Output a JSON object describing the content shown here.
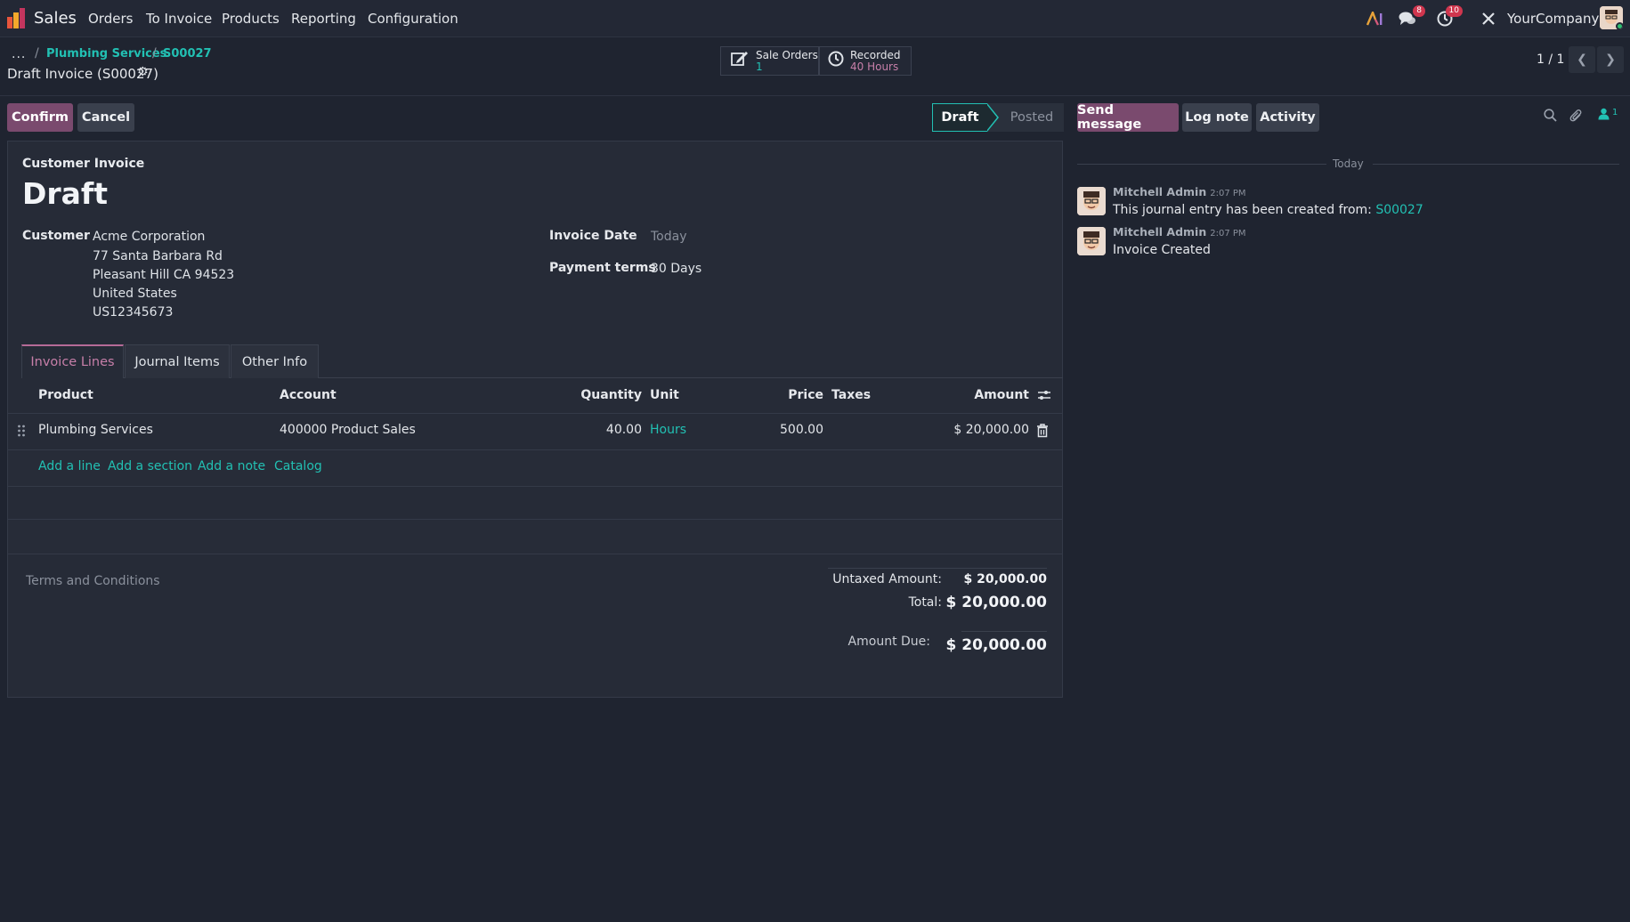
{
  "nav": {
    "app_name": "Sales",
    "menu": [
      "Orders",
      "To Invoice",
      "Products",
      "Reporting",
      "Configuration"
    ],
    "messages_badge": "8",
    "activities_badge": "10",
    "company": "YourCompany"
  },
  "breadcrumb": {
    "dots": "...",
    "items": [
      "Plumbing Services",
      "S00027"
    ],
    "record_title": "Draft Invoice (S00027)"
  },
  "smart_buttons": {
    "sale_orders_label": "Sale Orders",
    "sale_orders_count": "1",
    "recorded_label": "Recorded",
    "recorded_value": "40 Hours"
  },
  "pager": {
    "text": "1 / 1"
  },
  "actions": {
    "confirm": "Confirm",
    "cancel": "Cancel"
  },
  "status": {
    "current": "Draft",
    "next": "Posted"
  },
  "form": {
    "doc_type": "Customer Invoice",
    "name": "Draft",
    "customer_label": "Customer",
    "customer_lines": [
      "Acme Corporation",
      "77 Santa Barbara Rd",
      "Pleasant Hill CA 94523",
      "United States",
      "US12345673"
    ],
    "invoice_date_label": "Invoice Date",
    "invoice_date_value": "Today",
    "payment_terms_label": "Payment terms",
    "payment_terms_value": "30 Days"
  },
  "tabs": [
    "Invoice Lines",
    "Journal Items",
    "Other Info"
  ],
  "table": {
    "headers": {
      "product": "Product",
      "account": "Account",
      "quantity": "Quantity",
      "unit": "Unit",
      "price": "Price",
      "taxes": "Taxes",
      "amount": "Amount"
    },
    "rows": [
      {
        "product": "Plumbing Services",
        "account": "400000 Product Sales",
        "quantity": "40.00",
        "unit": "Hours",
        "price": "500.00",
        "taxes": "",
        "amount": "$ 20,000.00"
      }
    ],
    "add_links": [
      "Add a line",
      "Add a section",
      "Add a note",
      "Catalog"
    ]
  },
  "totals": {
    "terms_placeholder": "Terms and Conditions",
    "untaxed_label": "Untaxed Amount:",
    "untaxed_value": "$ 20,000.00",
    "total_label": "Total:",
    "total_value": "$ 20,000.00",
    "due_label": "Amount Due:",
    "due_value": "$ 20,000.00"
  },
  "chatter": {
    "send_message": "Send message",
    "log_note": "Log note",
    "activity": "Activity",
    "followers_count": "1",
    "day_label": "Today",
    "messages": [
      {
        "author": "Mitchell Admin",
        "time": "2:07 PM",
        "text": "This journal entry has been created from: ",
        "link": "S00027"
      },
      {
        "author": "Mitchell Admin",
        "time": "2:07 PM",
        "text": "Invoice Created",
        "link": ""
      }
    ]
  },
  "colors": {
    "accent": "#22c0b3",
    "primary_button": "#7a4a6e",
    "background": "#1f2430"
  }
}
